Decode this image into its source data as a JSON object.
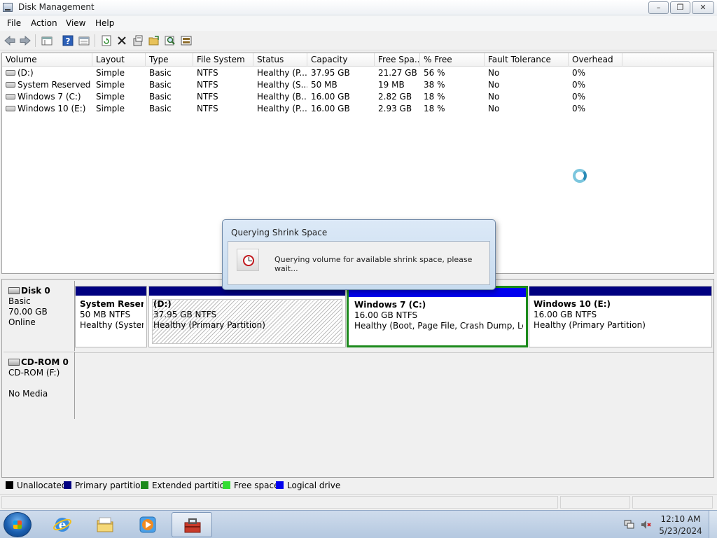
{
  "window": {
    "title": "Disk Management",
    "min_glyph": "–",
    "max_glyph": "❐",
    "close_glyph": "✕"
  },
  "menu": [
    "File",
    "Action",
    "View",
    "Help"
  ],
  "toolbar_icons": [
    "back-icon",
    "forward-icon",
    "properties-pane-icon",
    "help-icon",
    "pane-view-icon",
    "refresh-icon",
    "delete-icon",
    "properties-icon",
    "open-icon",
    "search-icon",
    "rescan-disks-icon"
  ],
  "columns": [
    "Volume",
    "Layout",
    "Type",
    "File System",
    "Status",
    "Capacity",
    "Free Spa...",
    "% Free",
    "Fault Tolerance",
    "Overhead"
  ],
  "volumes": [
    {
      "volume": "(D:)",
      "layout": "Simple",
      "type": "Basic",
      "fs": "NTFS",
      "status": "Healthy (P...",
      "capacity": "37.95 GB",
      "free": "21.27 GB",
      "pct": "56 %",
      "fault": "No",
      "overhead": "0%"
    },
    {
      "volume": "System Reserved",
      "layout": "Simple",
      "type": "Basic",
      "fs": "NTFS",
      "status": "Healthy (S...",
      "capacity": "50 MB",
      "free": "19 MB",
      "pct": "38 %",
      "fault": "No",
      "overhead": "0%"
    },
    {
      "volume": "Windows 7 (C:)",
      "layout": "Simple",
      "type": "Basic",
      "fs": "NTFS",
      "status": "Healthy (B...",
      "capacity": "16.00 GB",
      "free": "2.82 GB",
      "pct": "18 %",
      "fault": "No",
      "overhead": "0%"
    },
    {
      "volume": "Windows 10 (E:)",
      "layout": "Simple",
      "type": "Basic",
      "fs": "NTFS",
      "status": "Healthy (P...",
      "capacity": "16.00 GB",
      "free": "2.93 GB",
      "pct": "18 %",
      "fault": "No",
      "overhead": "0%"
    }
  ],
  "disk0": {
    "name": "Disk 0",
    "type": "Basic",
    "size": "70.00 GB",
    "state": "Online",
    "partitions": [
      {
        "name": "System Reserve",
        "size": "50 MB NTFS",
        "status": "Healthy (System,"
      },
      {
        "name": "(D:)",
        "size": "37.95 GB NTFS",
        "status": "Healthy (Primary Partition)"
      },
      {
        "name": "Windows 7  (C:)",
        "size": "16.00 GB NTFS",
        "status": "Healthy (Boot, Page File, Crash Dump, Logica"
      },
      {
        "name": "Windows 10  (E:)",
        "size": "16.00 GB NTFS",
        "status": "Healthy (Primary Partition)"
      }
    ]
  },
  "cdrom": {
    "name": "CD-ROM 0",
    "type": "CD-ROM (F:)",
    "media": "No Media"
  },
  "legend": [
    {
      "label": "Unallocated",
      "color": "#000000"
    },
    {
      "label": "Primary partition",
      "color": "#000080"
    },
    {
      "label": "Extended partition",
      "color": "#1c8a1c"
    },
    {
      "label": "Free space",
      "color": "#33dd33"
    },
    {
      "label": "Logical drive",
      "color": "#0000ee"
    }
  ],
  "dialog": {
    "title": "Querying Shrink Space",
    "message": "Querying volume for available shrink space, please wait..."
  },
  "taskbar": {
    "buttons": [
      "internet-explorer-icon",
      "windows-explorer-icon",
      "media-player-icon",
      "computer-management-icon"
    ],
    "time": "12:10 AM",
    "date": "5/23/2024"
  }
}
